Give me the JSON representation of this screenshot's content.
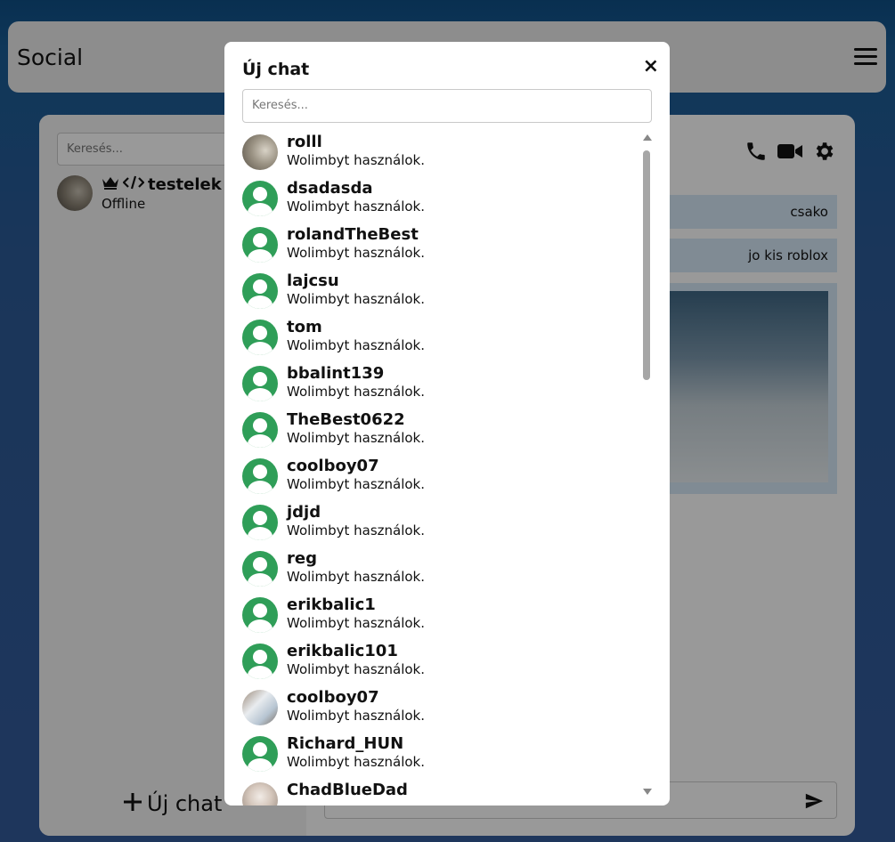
{
  "header": {
    "brand": "Social",
    "menu_icon": "hamburger-menu-icon"
  },
  "sidebar": {
    "search_placeholder": "Keresés...",
    "contact": {
      "name": "testelek",
      "status": "Offline",
      "icons": [
        "crown-icon",
        "code-icon"
      ]
    },
    "new_chat_label": "Új chat"
  },
  "chat": {
    "header_icons": [
      "phone-icon",
      "video-camera-icon",
      "gear-icon"
    ],
    "messages": [
      {
        "text": "csako"
      },
      {
        "text": "jo kis roblox"
      }
    ],
    "send_icon": "paper-plane-icon"
  },
  "modal": {
    "title": "Új chat",
    "close_label": "×",
    "search_placeholder": "Keresés...",
    "users": [
      {
        "name": "rolll",
        "subtitle": "Wolimbyt használok.",
        "avatar": "photo1"
      },
      {
        "name": "dsadasda",
        "subtitle": "Wolimbyt használok.",
        "avatar": "default"
      },
      {
        "name": "rolandTheBest",
        "subtitle": "Wolimbyt használok.",
        "avatar": "default"
      },
      {
        "name": "lajcsu",
        "subtitle": "Wolimbyt használok.",
        "avatar": "default"
      },
      {
        "name": "tom",
        "subtitle": "Wolimbyt használok.",
        "avatar": "default"
      },
      {
        "name": "bbalint139",
        "subtitle": "Wolimbyt használok.",
        "avatar": "default"
      },
      {
        "name": "TheBest0622",
        "subtitle": "Wolimbyt használok.",
        "avatar": "default"
      },
      {
        "name": "coolboy07",
        "subtitle": "Wolimbyt használok.",
        "avatar": "default"
      },
      {
        "name": "jdjd",
        "subtitle": "Wolimbyt használok.",
        "avatar": "default"
      },
      {
        "name": "reg",
        "subtitle": "Wolimbyt használok.",
        "avatar": "default"
      },
      {
        "name": "erikbalic1",
        "subtitle": "Wolimbyt használok.",
        "avatar": "default"
      },
      {
        "name": "erikbalic101",
        "subtitle": "Wolimbyt használok.",
        "avatar": "default"
      },
      {
        "name": "coolboy07",
        "subtitle": "Wolimbyt használok.",
        "avatar": "photo2"
      },
      {
        "name": "Richard_HUN",
        "subtitle": "Wolimbyt használok.",
        "avatar": "default"
      },
      {
        "name": "ChadBlueDad",
        "subtitle": "",
        "avatar": "photo3"
      }
    ]
  },
  "colors": {
    "accent": "#2f9e58",
    "message_bg": "#d6e8f7",
    "topbar_bg": "#ececec"
  }
}
